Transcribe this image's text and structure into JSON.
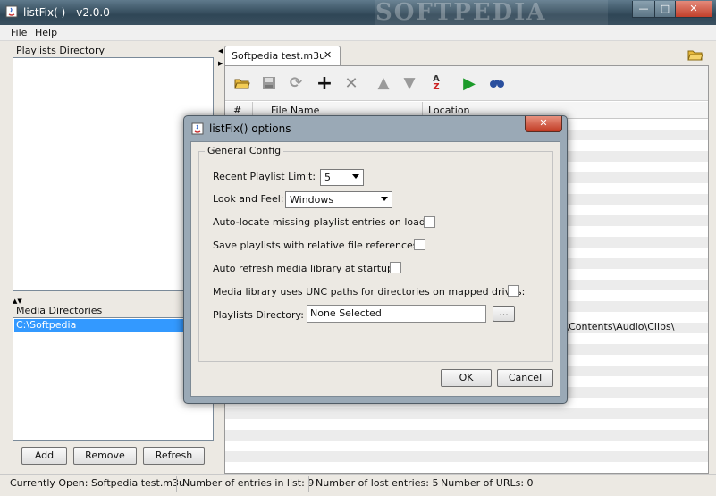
{
  "window": {
    "title": "listFix( ) - v2.0.0",
    "watermark": "SOFTPEDIA",
    "controls": {
      "minimize": "—",
      "maximize": "□",
      "close": "✕"
    }
  },
  "menu": {
    "items": [
      "File",
      "Help"
    ]
  },
  "left": {
    "playlists_label": "Playlists Directory",
    "media_label": "Media Directories",
    "media_items": [
      "C:\\Softpedia"
    ],
    "buttons": {
      "add": "Add",
      "remove": "Remove",
      "refresh": "Refresh"
    }
  },
  "editor": {
    "tab": {
      "label": "Softpedia test.m3u",
      "close": "✕"
    },
    "table": {
      "columns": [
        "#",
        "File Name",
        "Location"
      ]
    },
    "visible_location_fragment": "ct\\Contents\\Audio\\Clips\\"
  },
  "status": {
    "current": "Currently Open: Softpedia test.m3u",
    "entries": "Number of entries in list: 9",
    "lost": "Number of lost entries: 5",
    "urls": "Number of URLs: 0"
  },
  "dialog": {
    "title": "listFix() options",
    "close": "✕",
    "group": "General Config",
    "recent_limit": {
      "label": "Recent Playlist Limit:",
      "value": "5"
    },
    "look_feel": {
      "label": "Look and Feel:",
      "value": "Windows"
    },
    "options": [
      {
        "label": "Auto-locate missing playlist entries on load:",
        "checked": false
      },
      {
        "label": "Save playlists with relative file references:",
        "checked": false
      },
      {
        "label": "Auto refresh media library at startup:",
        "checked": false
      },
      {
        "label": "Media library uses UNC paths for directories on mapped drives:",
        "checked": false
      }
    ],
    "playlists_dir": {
      "label": "Playlists Directory:",
      "value": "None Selected",
      "browse": "..."
    },
    "ok": "OK",
    "cancel": "Cancel"
  }
}
